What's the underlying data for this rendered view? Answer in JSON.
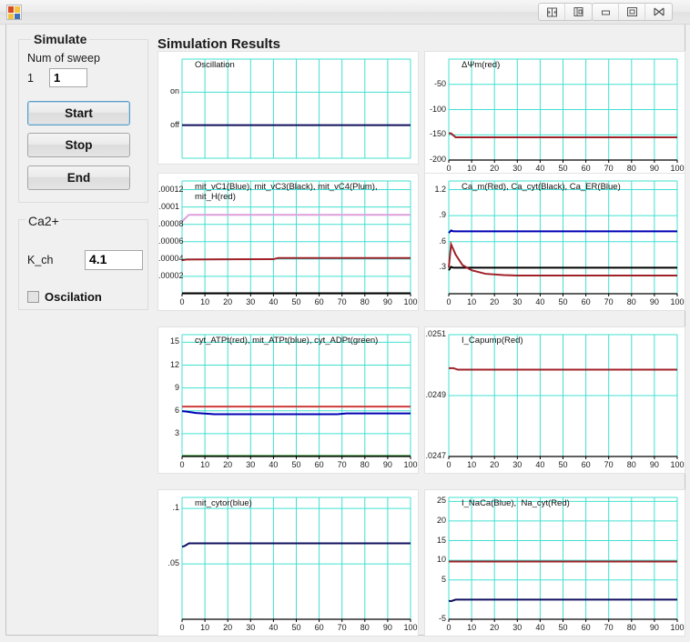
{
  "window": {
    "app_icon": "vb-app-icon",
    "controls": [
      {
        "name": "restore-split-button",
        "glyph": "split"
      },
      {
        "name": "restore-window-button",
        "glyph": "restore-doc"
      },
      {
        "name": "minimize-button",
        "glyph": "minimize"
      },
      {
        "name": "maximize-button",
        "glyph": "maximize"
      },
      {
        "name": "close-button",
        "glyph": "close"
      }
    ]
  },
  "left_panel": {
    "simulate": {
      "title": "Simulate",
      "num_of_sweep_label": "Num of sweep",
      "index_label": "1",
      "sweep_value": "1",
      "start_label": "Start",
      "stop_label": "Stop",
      "end_label": "End"
    },
    "ca": {
      "title": "Ca2+",
      "k_ch_label": "K_ch",
      "k_ch_value": "4.1",
      "oscilation_label": "Oscilation",
      "oscilation_checked": false
    }
  },
  "results": {
    "title": "Simulation Results"
  },
  "colors": {
    "grid": "#40e0d0",
    "axis": "#000000",
    "red": "#a02028",
    "blue": "#0000b4",
    "navy": "#101060",
    "black": "#000000",
    "plum": "#dda0dd",
    "green": "#006400",
    "panel": "#f0f0f0",
    "accent": "#5f9bc4"
  },
  "chart_data": [
    {
      "id": "oscillation",
      "type": "line",
      "title": "Oscillation",
      "xlabel": "",
      "ylabel": "",
      "xlim": [
        0,
        100
      ],
      "ylim": [
        0,
        3
      ],
      "xticks": [],
      "xticklabels": [],
      "yticks": [
        1,
        2
      ],
      "yticklabels": [
        "off",
        "on"
      ],
      "grid": true,
      "legend_position": "inside-top-left",
      "series": [
        {
          "name": "Oscillation",
          "color": "#101060",
          "x": [
            0,
            100
          ],
          "values": [
            1,
            1
          ]
        }
      ]
    },
    {
      "id": "psi-m",
      "type": "line",
      "title": "ΔΨm(red)",
      "xlabel": "",
      "ylabel": "",
      "xlim": [
        0,
        100
      ],
      "ylim": [
        -200,
        0
      ],
      "xticks": [
        0,
        10,
        20,
        30,
        40,
        50,
        60,
        70,
        80,
        90,
        100
      ],
      "xticklabels": [
        "0",
        "10",
        "20",
        "30",
        "40",
        "50",
        "60",
        "70",
        "80",
        "90",
        "100"
      ],
      "yticks": [
        -200,
        -150,
        -100,
        -50
      ],
      "yticklabels": [
        "-200",
        "-150",
        "-100",
        "-50"
      ],
      "grid": true,
      "legend_position": "inside-top-left",
      "series": [
        {
          "name": "ΔΨm",
          "color": "#a02028",
          "x": [
            0,
            1,
            3,
            100
          ],
          "values": [
            -147,
            -147,
            -155,
            -155
          ]
        }
      ]
    },
    {
      "id": "mit-vc",
      "type": "line",
      "title": "mit_vC1(Blue), mit_vC3(Black), mit_vC4(Plum),\nmit_H(red)",
      "xlabel": "",
      "ylabel": "",
      "xlim": [
        0,
        100
      ],
      "ylim": [
        0,
        0.00013
      ],
      "xticks": [
        0,
        10,
        20,
        30,
        40,
        50,
        60,
        70,
        80,
        90,
        100
      ],
      "xticklabels": [
        "0",
        "10",
        "20",
        "30",
        "40",
        "50",
        "60",
        "70",
        "80",
        "90",
        "100"
      ],
      "yticks": [
        2e-05,
        4e-05,
        6e-05,
        8e-05,
        0.0001,
        0.00012
      ],
      "yticklabels": [
        ".00002",
        ".00004",
        ".00006",
        ".00008",
        ".0001",
        ".00012"
      ],
      "grid": true,
      "legend_position": "inside-top-left",
      "series": [
        {
          "name": "mit_vC4",
          "color": "#dda0dd",
          "x": [
            0,
            1,
            3,
            100
          ],
          "values": [
            8.3e-05,
            8.6e-05,
            9.1e-05,
            9.1e-05
          ]
        },
        {
          "name": "mit_H",
          "color": "#a02028",
          "x": [
            0,
            2,
            40,
            42,
            100
          ],
          "values": [
            3.85e-05,
            3.95e-05,
            3.98e-05,
            4.12e-05,
            4.12e-05
          ]
        },
        {
          "name": "mit_vC1",
          "color": "#0000b4",
          "x": [
            0,
            100
          ],
          "values": [
            5e-07,
            5e-07
          ]
        },
        {
          "name": "mit_vC3",
          "color": "#000000",
          "x": [
            0,
            100
          ],
          "values": [
            5e-07,
            5e-07
          ]
        }
      ]
    },
    {
      "id": "calcium",
      "type": "line",
      "title": "Ca_m(Red), Ca_cyt(Black), Ca_ER(Blue)",
      "xlabel": "",
      "ylabel": "",
      "xlim": [
        0,
        100
      ],
      "ylim": [
        0,
        1.3
      ],
      "xticks": [
        0,
        10,
        20,
        30,
        40,
        50,
        60,
        70,
        80,
        90,
        100
      ],
      "xticklabels": [
        "0",
        "10",
        "20",
        "30",
        "40",
        "50",
        "60",
        "70",
        "80",
        "90",
        "100"
      ],
      "yticks": [
        0.3,
        0.6,
        0.9,
        1.2
      ],
      "yticklabels": [
        ".3",
        ".6",
        ".9",
        "1.2"
      ],
      "grid": true,
      "legend_position": "inside-top-left",
      "series": [
        {
          "name": "Ca_ER",
          "color": "#0000b4",
          "x": [
            0,
            1,
            2,
            100
          ],
          "values": [
            0.7,
            0.73,
            0.72,
            0.72
          ]
        },
        {
          "name": "Ca_cyt",
          "color": "#000000",
          "x": [
            0,
            1,
            2,
            100
          ],
          "values": [
            0.27,
            0.31,
            0.3,
            0.3
          ]
        },
        {
          "name": "Ca_m",
          "color": "#a02028",
          "x": [
            0,
            1,
            3,
            6,
            10,
            16,
            24,
            30,
            100
          ],
          "values": [
            0.3,
            0.57,
            0.45,
            0.33,
            0.27,
            0.23,
            0.215,
            0.21,
            0.21
          ]
        }
      ]
    },
    {
      "id": "atp-adp",
      "type": "line",
      "title": "cyt_ATPt(red), mit_ATPt(blue), cyt_ADPt(green)",
      "xlabel": "",
      "ylabel": "",
      "xlim": [
        0,
        100
      ],
      "ylim": [
        0,
        16
      ],
      "xticks": [
        0,
        10,
        20,
        30,
        40,
        50,
        60,
        70,
        80,
        90,
        100
      ],
      "xticklabels": [
        "0",
        "10",
        "20",
        "30",
        "40",
        "50",
        "60",
        "70",
        "80",
        "90",
        "100"
      ],
      "yticks": [
        3,
        6,
        9,
        12,
        15
      ],
      "yticklabels": [
        "3",
        "6",
        "9",
        "12",
        "15"
      ],
      "grid": true,
      "legend_position": "inside-top-left",
      "series": [
        {
          "name": "cyt_ATPt",
          "color": "#d03a3a",
          "x": [
            0,
            100
          ],
          "values": [
            6.55,
            6.55
          ]
        },
        {
          "name": "mit_ATPt",
          "color": "#0000b4",
          "x": [
            0,
            2,
            6,
            12,
            14,
            68,
            72,
            100
          ],
          "values": [
            5.95,
            5.9,
            5.72,
            5.6,
            5.55,
            5.55,
            5.65,
            5.65
          ]
        },
        {
          "name": "cyt_ADPt",
          "color": "#006400",
          "x": [
            0,
            100
          ],
          "values": [
            0.06,
            0.06
          ]
        }
      ]
    },
    {
      "id": "i-capump",
      "type": "line",
      "title": "I_Capump(Red)",
      "xlabel": "",
      "ylabel": "",
      "xlim": [
        0,
        100
      ],
      "ylim": [
        0.0247,
        0.0251
      ],
      "xticks": [
        0,
        10,
        20,
        30,
        40,
        50,
        60,
        70,
        80,
        90,
        100
      ],
      "xticklabels": [
        "0",
        "10",
        "20",
        "30",
        "40",
        "50",
        "60",
        "70",
        "80",
        "90",
        "100"
      ],
      "yticks": [
        0.0247,
        0.0249,
        0.0251
      ],
      "yticklabels": [
        ".0247",
        ".0249",
        ".0251"
      ],
      "grid": true,
      "legend_position": "inside-top-left",
      "series": [
        {
          "name": "I_Capump",
          "color": "#a02028",
          "x": [
            0,
            2,
            4,
            100
          ],
          "values": [
            0.02499,
            0.02499,
            0.024985,
            0.024985
          ]
        }
      ]
    },
    {
      "id": "mit-cytor",
      "type": "line",
      "title": "mit_cytor(blue)",
      "xlabel": "",
      "ylabel": "",
      "xlim": [
        0,
        100
      ],
      "ylim": [
        0,
        0.11
      ],
      "xticks": [
        0,
        10,
        20,
        30,
        40,
        50,
        60,
        70,
        80,
        90,
        100
      ],
      "xticklabels": [
        "0",
        "10",
        "20",
        "30",
        "40",
        "50",
        "60",
        "70",
        "80",
        "90",
        "100"
      ],
      "yticks": [
        0.05,
        0.1
      ],
      "yticklabels": [
        ".05",
        ".1"
      ],
      "grid": true,
      "legend_position": "inside-top-left",
      "series": [
        {
          "name": "mit_cytor",
          "color": "#101060",
          "x": [
            0,
            1,
            3,
            100
          ],
          "values": [
            0.0655,
            0.066,
            0.0685,
            0.0685
          ]
        }
      ]
    },
    {
      "id": "i-naca",
      "type": "line",
      "title": "I_NaCa(Blue),  Na_cyt(Red)",
      "xlabel": "",
      "ylabel": "",
      "xlim": [
        0,
        100
      ],
      "ylim": [
        -5,
        26
      ],
      "xticks": [
        0,
        10,
        20,
        30,
        40,
        50,
        60,
        70,
        80,
        90,
        100
      ],
      "xticklabels": [
        "0",
        "10",
        "20",
        "30",
        "40",
        "50",
        "60",
        "70",
        "80",
        "90",
        "100"
      ],
      "yticks": [
        -5,
        5,
        10,
        15,
        20,
        25
      ],
      "yticklabels": [
        "-5",
        "5",
        "10",
        "15",
        "20",
        "25"
      ],
      "grid": true,
      "legend_position": "inside-top-left",
      "series": [
        {
          "name": "Na_cyt",
          "color": "#a02028",
          "x": [
            0,
            100
          ],
          "values": [
            9.7,
            9.7
          ]
        },
        {
          "name": "I_NaCa",
          "color": "#101060",
          "x": [
            0,
            1,
            3,
            100
          ],
          "values": [
            -0.3,
            -0.4,
            0.0,
            0.0
          ]
        }
      ]
    }
  ]
}
